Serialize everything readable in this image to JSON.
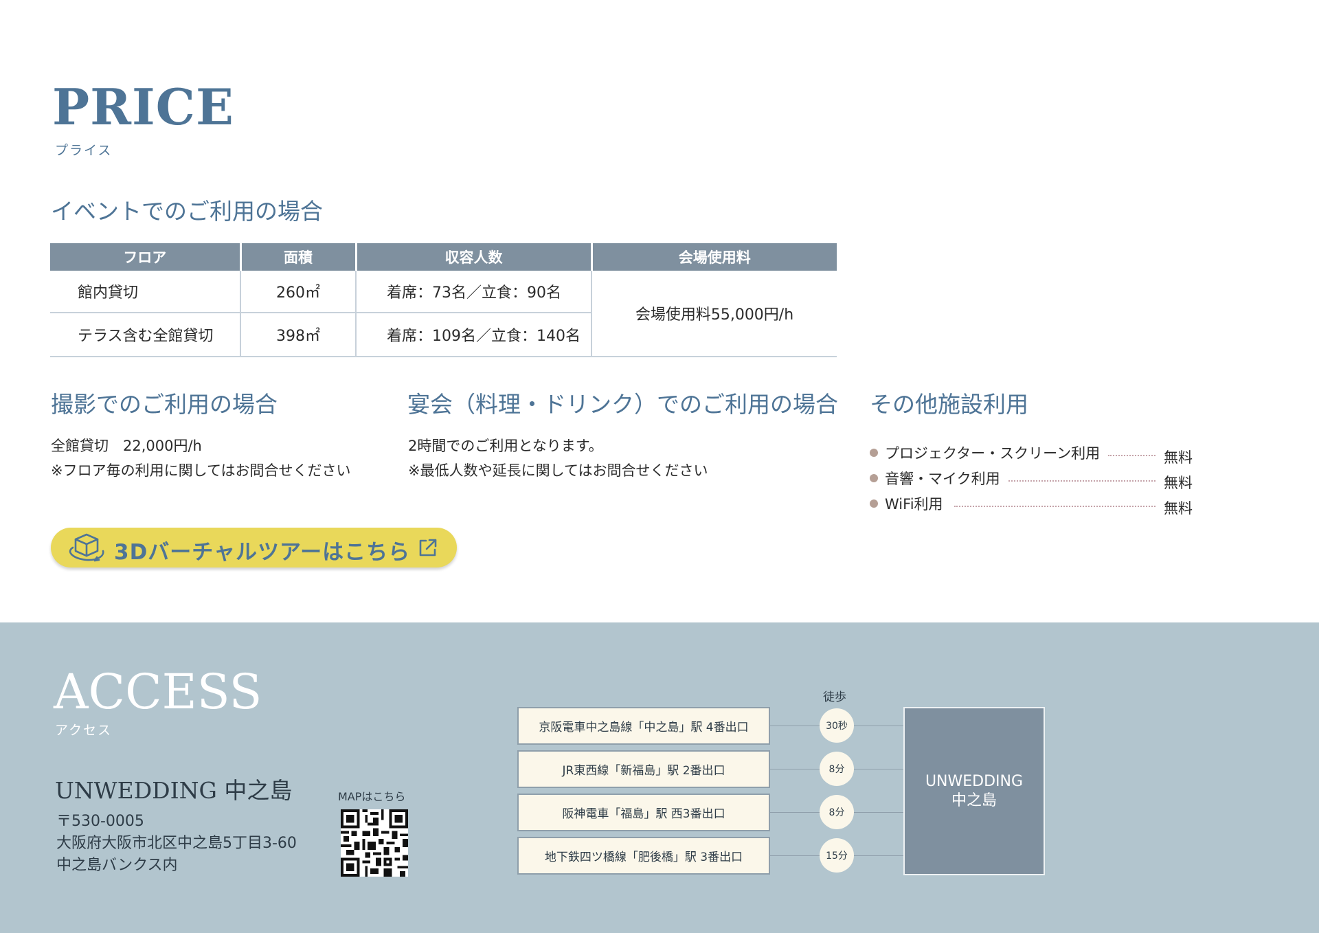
{
  "price": {
    "title": "PRICE",
    "subtitle": "プライス"
  },
  "event": {
    "heading": "イベントでのご利用の場合",
    "columns": [
      "フロア",
      "面積",
      "収容人数",
      "会場使用料"
    ],
    "rows": [
      {
        "floor": "館内貸切",
        "area": "260㎡",
        "capacity": "着席：73名／立食：90名"
      },
      {
        "floor": "テラス含む全館貸切",
        "area": "398㎡",
        "capacity": "着席：109名／立食：140名"
      }
    ],
    "fee": "会場使用料55,000円/h"
  },
  "photo": {
    "heading": "撮影でのご利用の場合",
    "line1": "全館貸切　22,000円/h",
    "line2": "※フロア毎の利用に関してはお問合せください"
  },
  "banquet": {
    "heading": "宴会（料理・ドリンク）でのご利用の場合",
    "line1": "2時間でのご利用となります。",
    "line2": "※最低人数や延長に関してはお問合せください"
  },
  "facilities": {
    "heading": "その他施設利用",
    "items": [
      {
        "name": "プロジェクター・スクリーン利用",
        "price": "無料"
      },
      {
        "name": "音響・マイク利用",
        "price": "無料"
      },
      {
        "name": "WiFi利用",
        "price": "無料"
      }
    ]
  },
  "tour": {
    "label": "3Dバーチャルツアーはこちら"
  },
  "access": {
    "title": "ACCESS",
    "subtitle": "アクセス",
    "venue": "UNWEDDING 中之島",
    "postal": "〒530-0005",
    "address1": "大阪府大阪市北区中之島5丁目3-60",
    "address2": "中之島バンクス内",
    "map_label": "MAPはこちら",
    "walk_label": "徒歩",
    "stations": [
      {
        "name": "京阪電車中之島線「中之島」駅 4番出口",
        "time": "30秒"
      },
      {
        "name": "JR東西線「新福島」駅 2番出口",
        "time": "8分"
      },
      {
        "name": "阪神電車「福島」駅 西3番出口",
        "time": "8分"
      },
      {
        "name": "地下鉄四ツ橋線「肥後橋」駅 3番出口",
        "time": "15分"
      }
    ],
    "dest_line1": "UNWEDDING",
    "dest_line2": "中之島"
  },
  "colors": {
    "accent": "#4e7496",
    "table_header": "#7f909f",
    "button": "#e9d85a",
    "access_bg": "#b2c5ce"
  }
}
